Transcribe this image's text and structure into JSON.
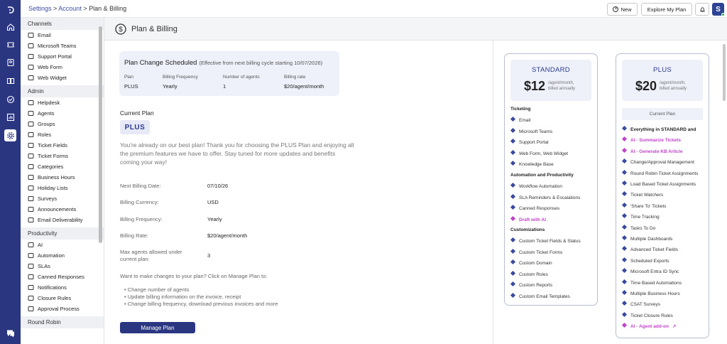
{
  "breadcrumb": {
    "settings": "Settings",
    "sep1": " > ",
    "account": "Account",
    "sep2": " > ",
    "current": "Plan & Billing"
  },
  "topbar": {
    "new_label": "New",
    "explore_label": "Explore My Plan",
    "avatar_initial": "S"
  },
  "page": {
    "title": "Plan & Billing"
  },
  "sidebar": {
    "sections": [
      {
        "title": "Channels",
        "items": [
          {
            "label": "Email",
            "icon": "mail-icon"
          },
          {
            "label": "Microsoft Teams",
            "icon": "teams-icon"
          },
          {
            "label": "Support Portal",
            "icon": "portal-icon"
          },
          {
            "label": "Web Form",
            "icon": "form-icon"
          },
          {
            "label": "Web Widget",
            "icon": "widget-icon"
          }
        ]
      },
      {
        "title": "Admin",
        "items": [
          {
            "label": "Helpdesk",
            "icon": "helpdesk-icon"
          },
          {
            "label": "Agents",
            "icon": "agent-icon"
          },
          {
            "label": "Groups",
            "icon": "groups-icon"
          },
          {
            "label": "Roles",
            "icon": "roles-icon"
          },
          {
            "label": "Ticket Fields",
            "icon": "ticket-fields-icon"
          },
          {
            "label": "Ticket Forms",
            "icon": "ticket-forms-icon"
          },
          {
            "label": "Categories",
            "icon": "categories-icon"
          },
          {
            "label": "Business Hours",
            "icon": "hourglass-icon"
          },
          {
            "label": "Holiday Lists",
            "icon": "calendar-icon"
          },
          {
            "label": "Surveys",
            "icon": "survey-icon"
          },
          {
            "label": "Announcements",
            "icon": "announcement-icon"
          },
          {
            "label": "Email Deliverability",
            "icon": "deliverability-icon"
          }
        ]
      },
      {
        "title": "Productivity",
        "items": [
          {
            "label": "AI",
            "icon": "ai-icon"
          },
          {
            "label": "Automation",
            "icon": "automation-icon"
          },
          {
            "label": "SLAs",
            "icon": "sla-icon"
          },
          {
            "label": "Canned Responses",
            "icon": "canned-icon"
          },
          {
            "label": "Notifications",
            "icon": "bell-icon"
          },
          {
            "label": "Closure Rules",
            "icon": "closure-icon"
          },
          {
            "label": "Approval Process",
            "icon": "approval-icon"
          }
        ]
      },
      {
        "title": "Round Robin",
        "items": []
      }
    ]
  },
  "schedule": {
    "title": "Plan Change Scheduled",
    "subtitle": "(Effective from next billing cycle starting 10/07/2026)",
    "cols": [
      {
        "label": "Plan",
        "value": "PLUS"
      },
      {
        "label": "Billing Frequency",
        "value": "Yearly"
      },
      {
        "label": "Number of agents",
        "value": "1"
      },
      {
        "label": "Billing rate",
        "value": "$20/agent/month"
      }
    ]
  },
  "current_plan": {
    "title": "Current Plan",
    "badge": "PLUS",
    "message": "You're already on our best plan! Thank you for choosing the PLUS Plan and enjoying all the premium features we have to offer. Stay tuned for more updates and benefits coming your way!"
  },
  "details": [
    {
      "label": "Next Billing Date:",
      "value": "07/10/26"
    },
    {
      "label": "Billing Currency:",
      "value": "USD"
    },
    {
      "label": "Billing Frequency:",
      "value": "Yearly"
    },
    {
      "label": "Billing Rate:",
      "value": "$20/agent/month"
    },
    {
      "label": "Max agents allowed under current plan:",
      "value": "3"
    }
  ],
  "changes": {
    "intro": "Want to make changes to your plan? Click on Manage Plan to:",
    "items": [
      "Change number of agents",
      "Update billing information on the invoice, receipt",
      "Change billing frequency, download previous invoices and more"
    ]
  },
  "manage_button": "Manage Plan",
  "plans": {
    "standard": {
      "name": "STANDARD",
      "price": "$12",
      "period1": "/agent/month,",
      "period2": "billed annually",
      "features": [
        {
          "text": "Ticketing",
          "kind": "head"
        },
        {
          "text": "Email",
          "kind": "item"
        },
        {
          "text": "Microsoft Teams",
          "kind": "item"
        },
        {
          "text": "Support Portal",
          "kind": "item"
        },
        {
          "text": "Web Form, Web Widget",
          "kind": "item"
        },
        {
          "text": "Knowledge Base",
          "kind": "item"
        },
        {
          "text": "Automation and Productivity",
          "kind": "head"
        },
        {
          "text": "Workflow Automation",
          "kind": "item"
        },
        {
          "text": "SLA Reminders & Escalations",
          "kind": "item"
        },
        {
          "text": "Canned Responses",
          "kind": "item"
        },
        {
          "text": "Draft with AI",
          "kind": "pink"
        },
        {
          "text": "Customizations",
          "kind": "head"
        },
        {
          "text": "Custom Ticket Fields & Status",
          "kind": "item"
        },
        {
          "text": "Custom Ticket Forms",
          "kind": "item"
        },
        {
          "text": "Custom Domain",
          "kind": "item"
        },
        {
          "text": "Custom Roles",
          "kind": "item"
        },
        {
          "text": "Custom Reports",
          "kind": "item"
        },
        {
          "text": "Custom Email Templates",
          "kind": "item"
        }
      ]
    },
    "plus": {
      "name": "PLUS",
      "price": "$20",
      "period1": "/agent/month,",
      "period2": "billed annually",
      "current_label": "Current Plan",
      "features": [
        {
          "text": "Everything in STANDARD and",
          "kind": "headdot"
        },
        {
          "text": "AI - Summarize Tickets",
          "kind": "pink"
        },
        {
          "text": "AI - Generate KB Article",
          "kind": "pink"
        },
        {
          "text": "Change/Approval Management",
          "kind": "item"
        },
        {
          "text": "Round Robin Ticket Assignments",
          "kind": "item"
        },
        {
          "text": "Load Based Ticket Assignments",
          "kind": "item"
        },
        {
          "text": "Ticket Watchers",
          "kind": "item"
        },
        {
          "text": "'Share To' Tickets",
          "kind": "item"
        },
        {
          "text": "Time Tracking",
          "kind": "item"
        },
        {
          "text": "Tasks To Do",
          "kind": "item"
        },
        {
          "text": "Multiple Dashboards",
          "kind": "item"
        },
        {
          "text": "Advanced Ticket Fields",
          "kind": "item"
        },
        {
          "text": "Scheduled Exports",
          "kind": "item"
        },
        {
          "text": "Microsoft Entra ID Sync",
          "kind": "item"
        },
        {
          "text": "Time Based Automations",
          "kind": "item"
        },
        {
          "text": "Multiple Business Hours",
          "kind": "item"
        },
        {
          "text": "CSAT Surveys",
          "kind": "item"
        },
        {
          "text": "Ticket Closure Rules",
          "kind": "item"
        },
        {
          "text": "AI - Agent add-on",
          "kind": "pinklink"
        }
      ]
    }
  },
  "colors": {
    "brand": "#2b3680",
    "accent_pink": "#c043c9",
    "link": "#3d4ea5"
  }
}
